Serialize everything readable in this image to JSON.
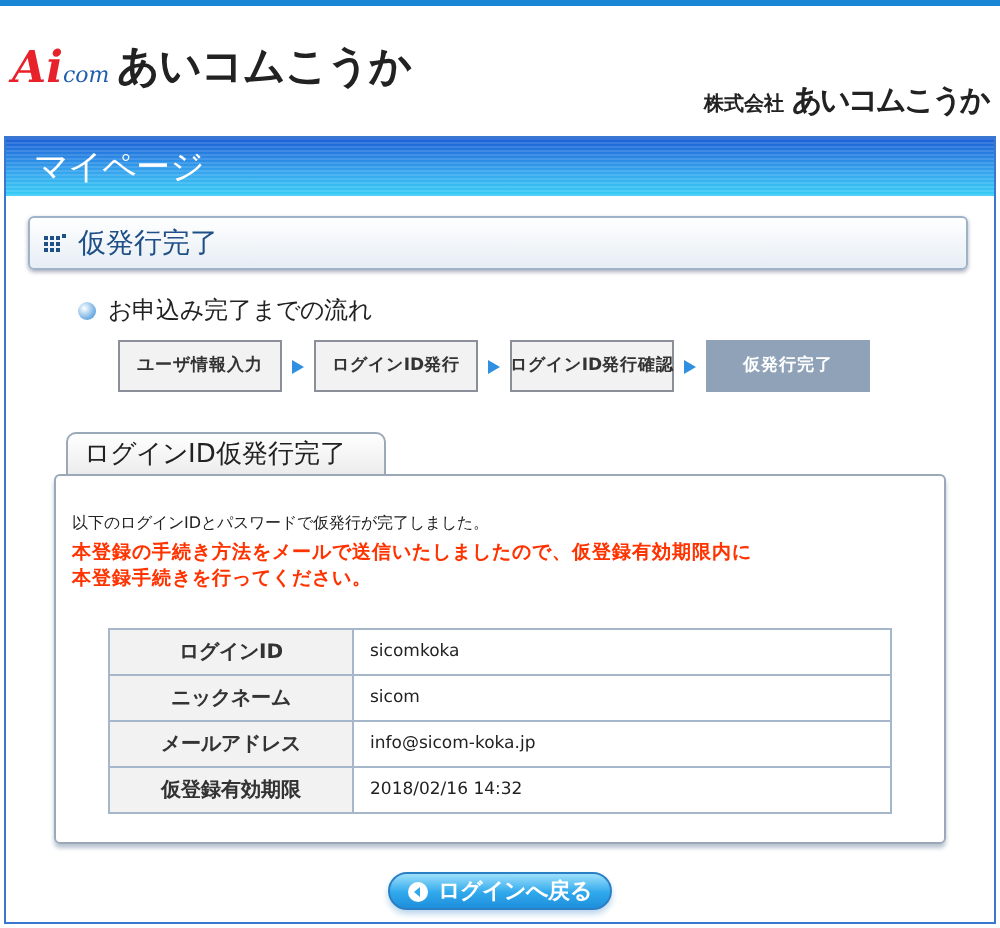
{
  "header": {
    "logo": {
      "mark_letters": "Ai",
      "mark_suffix": "com",
      "name": "あいコムこうか"
    },
    "company": {
      "prefix": "株式会社",
      "name": "あいコムこうか"
    }
  },
  "page_title": "マイページ",
  "section_title": "仮発行完了",
  "flow": {
    "heading": "お申込み完了までの流れ",
    "steps": [
      {
        "label": "ユーザ情報入力",
        "selected": false
      },
      {
        "label": "ログインID発行",
        "selected": false
      },
      {
        "label": "ログインID発行確認",
        "selected": false
      },
      {
        "label": "仮発行完了",
        "selected": true
      }
    ]
  },
  "result": {
    "tab": "ログインID仮発行完了",
    "message": "以下のログインIDとパスワードで仮発行が完了しました。",
    "notice": "本登録の手続き方法をメールで送信いたしましたので、仮登録有効期限内に本登録手続きを行ってください。",
    "rows": [
      {
        "label": "ログインID",
        "value": "sicomkoka"
      },
      {
        "label": "ニックネーム",
        "value": "sicom"
      },
      {
        "label": "メールアドレス",
        "value": "info@sicom-koka.jp"
      },
      {
        "label": "仮登録有効期限",
        "value": "2018/02/16 14:32"
      }
    ]
  },
  "back_button": "ログインへ戻る"
}
